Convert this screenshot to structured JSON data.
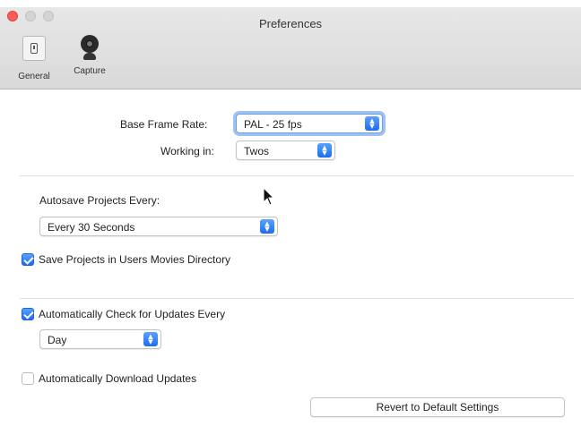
{
  "window": {
    "title": "Preferences"
  },
  "toolbar": {
    "tabs": [
      {
        "label": "General",
        "icon": "switch-icon",
        "selected": true
      },
      {
        "label": "Capture",
        "icon": "webcam-icon",
        "selected": false
      }
    ]
  },
  "general": {
    "base_frame_rate": {
      "label": "Base Frame Rate:",
      "value": "PAL - 25 fps"
    },
    "working_in": {
      "label": "Working in:",
      "value": "Twos"
    },
    "autosave": {
      "label": "Autosave Projects Every:",
      "value": "Every 30 Seconds"
    },
    "save_in_movies": {
      "label": "Save Projects in Users Movies Directory",
      "checked": true
    },
    "check_updates": {
      "label": "Automatically Check for Updates Every",
      "checked": true
    },
    "update_interval": {
      "value": "Day"
    },
    "download_updates": {
      "label": "Automatically Download Updates",
      "checked": false
    },
    "revert_button": {
      "label": "Revert to Default Settings"
    }
  },
  "colors": {
    "accent": "#1e6cf0",
    "close_button": "#fd5d5a",
    "focus_ring": "#9ec3f1"
  }
}
